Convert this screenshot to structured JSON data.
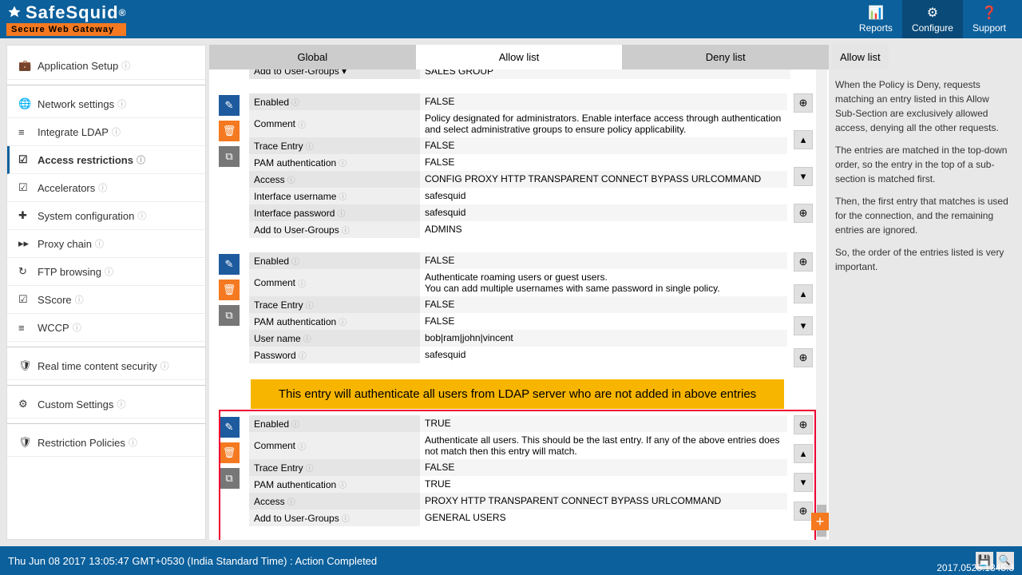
{
  "header": {
    "brand": "SafeSquid",
    "brand_sub": "Secure Web Gateway",
    "nav": {
      "reports": "Reports",
      "configure": "Configure",
      "support": "Support"
    }
  },
  "sidebar": {
    "items": [
      {
        "icon": "💼",
        "label": "Application Setup"
      },
      {
        "icon": "🌐",
        "label": "Network settings"
      },
      {
        "icon": "≡",
        "label": "Integrate LDAP"
      },
      {
        "icon": "☑",
        "label": "Access restrictions"
      },
      {
        "icon": "☑",
        "label": "Accelerators"
      },
      {
        "icon": "➕",
        "label": "System configuration"
      },
      {
        "icon": "▶▶",
        "label": "Proxy chain"
      },
      {
        "icon": "⟳",
        "label": "FTP browsing"
      },
      {
        "icon": "☑",
        "label": "SScore"
      },
      {
        "icon": "≡",
        "label": "WCCP"
      },
      {
        "icon": "🛡",
        "label": "Real time content security"
      },
      {
        "icon": "⚙",
        "label": "Custom Settings"
      },
      {
        "icon": "🛡",
        "label": "Restriction Policies"
      }
    ]
  },
  "tabs": {
    "global": "Global",
    "allow": "Allow list",
    "deny": "Deny list"
  },
  "partial": {
    "label": "Add to User-Groups  ▾",
    "val": "SALES GROUP"
  },
  "entry1": {
    "r0": {
      "l": "Enabled",
      "v": "FALSE"
    },
    "r1": {
      "l": "Comment",
      "v": "Policy designated for administrators. Enable interface access through authentication and select administrative groups to ensure policy applicability."
    },
    "r2": {
      "l": "Trace Entry",
      "v": "FALSE"
    },
    "r3": {
      "l": "PAM authentication",
      "v": "FALSE"
    },
    "r4": {
      "l": "Access",
      "v": "CONFIG  PROXY  HTTP  TRANSPARENT  CONNECT  BYPASS  URLCOMMAND"
    },
    "r5": {
      "l": "Interface username",
      "v": "safesquid"
    },
    "r6": {
      "l": "Interface password",
      "v": "safesquid"
    },
    "r7": {
      "l": "Add to User-Groups",
      "v": "ADMINS"
    }
  },
  "entry2": {
    "r0": {
      "l": "Enabled",
      "v": "FALSE"
    },
    "r1": {
      "l": "Comment",
      "v": "Authenticate roaming users or guest users.\nYou can add multiple usernames with same password in single policy."
    },
    "r2": {
      "l": "Trace Entry",
      "v": "FALSE"
    },
    "r3": {
      "l": "PAM authentication",
      "v": "FALSE"
    },
    "r4": {
      "l": "User name",
      "v": "bob|ram|john|vincent"
    },
    "r5": {
      "l": "Password",
      "v": "safesquid"
    }
  },
  "callout": "This entry will authenticate all users from LDAP server who are not added in above entries",
  "entry3": {
    "r0": {
      "l": "Enabled",
      "v": "TRUE"
    },
    "r1": {
      "l": "Comment",
      "v": "Authenticate all users. This should be the last entry. If any of the above entries does not match then this entry will match."
    },
    "r2": {
      "l": "Trace Entry",
      "v": "FALSE"
    },
    "r3": {
      "l": "PAM authentication",
      "v": "TRUE"
    },
    "r4": {
      "l": "Access",
      "v": "PROXY  HTTP  TRANSPARENT  CONNECT  BYPASS  URLCOMMAND"
    },
    "r5": {
      "l": "Add to User-Groups",
      "v": "GENERAL USERS"
    }
  },
  "rpanel": {
    "title": "Allow list",
    "p1": "When the Policy is Deny, requests matching an entry listed in this Allow Sub-Section are exclusively allowed access, denying all the other requests.",
    "p2": "The entries are matched in the top-down order, so the entry in the top of a sub-section is matched first.",
    "p3": "Then, the first entry that matches is used for the connection, and the remaining entries are ignored.",
    "p4": "So, the order of the entries listed is very important."
  },
  "footer": {
    "status": "Thu Jun 08 2017 13:05:47 GMT+0530 (India Standard Time) : Action Completed",
    "version": "2017.0525.1345.3"
  }
}
